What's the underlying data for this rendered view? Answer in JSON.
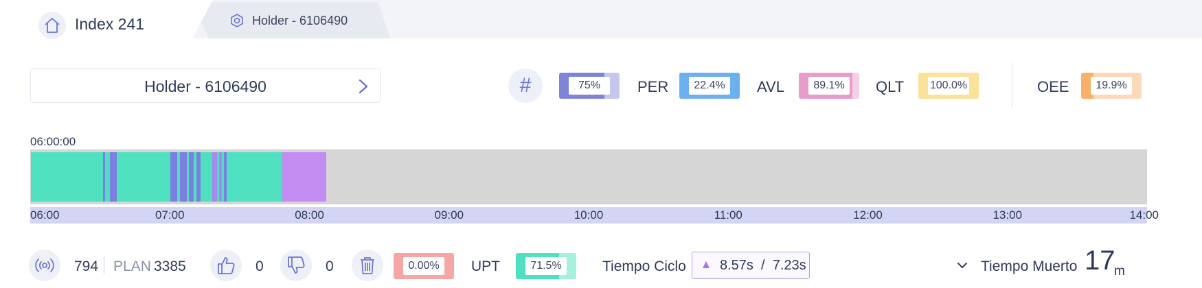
{
  "tabs": {
    "active_title": "Index 241",
    "inactive_title": "Holder - 6106490"
  },
  "selector": {
    "label": "Holder - 6106490"
  },
  "kpis": {
    "count": {
      "value": "75%",
      "fill": 0.75,
      "color": "#8084d8",
      "bg": "#c5c7ef"
    },
    "per": {
      "label": "PER",
      "value": "22.4%",
      "fill": 1.0,
      "color": "#6db0ee",
      "bg": "#6db0ee"
    },
    "avl": {
      "label": "AVL",
      "value": "89.1%",
      "fill": 0.891,
      "color": "#e79ccb",
      "bg": "#f4cfe6"
    },
    "qlt": {
      "label": "QLT",
      "value": "100.0%",
      "fill": 1.0,
      "color": "#fbe29a",
      "bg": "#fbe29a"
    },
    "oee": {
      "label": "OEE",
      "value": "19.9%",
      "fill": 0.199,
      "color": "#f8b06b",
      "bg": "#fbd9b9"
    }
  },
  "timeline": {
    "start_label": "06:00:00",
    "range_hours": [
      6,
      14
    ],
    "ticks": [
      "06:00",
      "07:00",
      "08:00",
      "09:00",
      "10:00",
      "11:00",
      "12:00",
      "13:00",
      "14:00"
    ],
    "colors": {
      "running": "#4fe0c0",
      "stop": "#7b7fe0",
      "stop_light": "#a68af0",
      "setup": "#c38cf0",
      "idle": "#d6d6d6"
    },
    "segments": [
      {
        "start": "06:00",
        "end": "06:31",
        "state": "running"
      },
      {
        "start": "06:31",
        "end": "06:32",
        "state": "stop"
      },
      {
        "start": "06:32",
        "end": "06:34",
        "state": "running"
      },
      {
        "start": "06:34",
        "end": "06:37",
        "state": "stop"
      },
      {
        "start": "06:37",
        "end": "07:00",
        "state": "running"
      },
      {
        "start": "07:00",
        "end": "07:03",
        "state": "stop"
      },
      {
        "start": "07:03",
        "end": "07:04",
        "state": "running"
      },
      {
        "start": "07:04",
        "end": "07:07",
        "state": "stop"
      },
      {
        "start": "07:07",
        "end": "07:08",
        "state": "running"
      },
      {
        "start": "07:08",
        "end": "07:10",
        "state": "stop"
      },
      {
        "start": "07:10",
        "end": "07:11",
        "state": "running"
      },
      {
        "start": "07:11",
        "end": "07:13",
        "state": "stop"
      },
      {
        "start": "07:13",
        "end": "07:18",
        "state": "running"
      },
      {
        "start": "07:18",
        "end": "07:20",
        "state": "stop_light"
      },
      {
        "start": "07:20",
        "end": "07:21",
        "state": "running"
      },
      {
        "start": "07:21",
        "end": "07:22",
        "state": "stop_light"
      },
      {
        "start": "07:22",
        "end": "07:23",
        "state": "running"
      },
      {
        "start": "07:23",
        "end": "07:24",
        "state": "stop"
      },
      {
        "start": "07:24",
        "end": "07:48",
        "state": "running"
      },
      {
        "start": "07:48",
        "end": "08:07",
        "state": "setup"
      }
    ]
  },
  "bottom": {
    "produced": "794",
    "plan_label": "PLAN",
    "plan_value": "3385",
    "good": "0",
    "bad": "0",
    "scrap": {
      "value": "0.00%",
      "fill": 1.0,
      "color": "#f7a6a6",
      "bg": "#f7a6a6"
    },
    "upt": {
      "label": "UPT",
      "value": "71.5%",
      "fill": 0.715,
      "color": "#4fe0c0",
      "bg": "#a6f0df"
    },
    "cycle_label": "Tiempo Ciclo",
    "cycle_value": "8.57s  /  7.23s",
    "dead_label": "Tiempo Muerto",
    "dead_value": "17",
    "dead_unit": "m"
  }
}
